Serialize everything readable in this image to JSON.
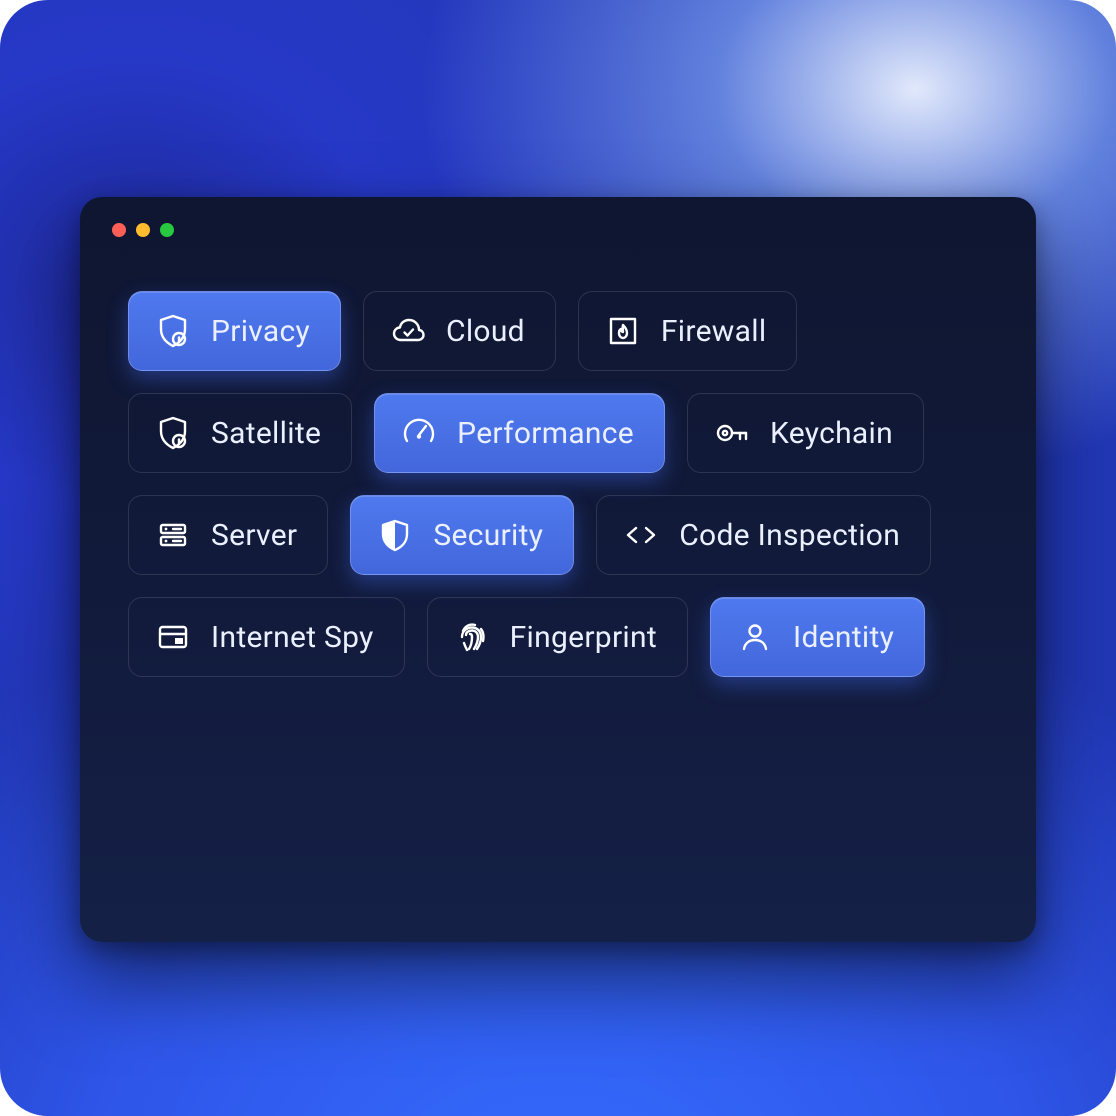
{
  "colors": {
    "accent": "#4a70e6",
    "window_bg": "#111a3a",
    "text": "#eaf0ff"
  },
  "tags": [
    {
      "id": "privacy",
      "label": "Privacy",
      "icon": "shield-lock-icon",
      "active": true
    },
    {
      "id": "cloud",
      "label": "Cloud",
      "icon": "cloud-check-icon",
      "active": false
    },
    {
      "id": "firewall",
      "label": "Firewall",
      "icon": "fireplace-icon",
      "active": false
    },
    {
      "id": "satellite",
      "label": "Satellite",
      "icon": "shield-lock-icon",
      "active": false
    },
    {
      "id": "performance",
      "label": "Performance",
      "icon": "gauge-icon",
      "active": true
    },
    {
      "id": "keychain",
      "label": "Keychain",
      "icon": "key-icon",
      "active": false
    },
    {
      "id": "server",
      "label": "Server",
      "icon": "server-icon",
      "active": false
    },
    {
      "id": "security",
      "label": "Security",
      "icon": "shield-half-icon",
      "active": true
    },
    {
      "id": "code-inspection",
      "label": "Code Inspection",
      "icon": "code-icon",
      "active": false
    },
    {
      "id": "internet-spy",
      "label": "Internet Spy",
      "icon": "browser-icon",
      "active": false
    },
    {
      "id": "fingerprint",
      "label": "Fingerprint",
      "icon": "fingerprint-icon",
      "active": false
    },
    {
      "id": "identity",
      "label": "Identity",
      "icon": "person-icon",
      "active": true
    }
  ]
}
